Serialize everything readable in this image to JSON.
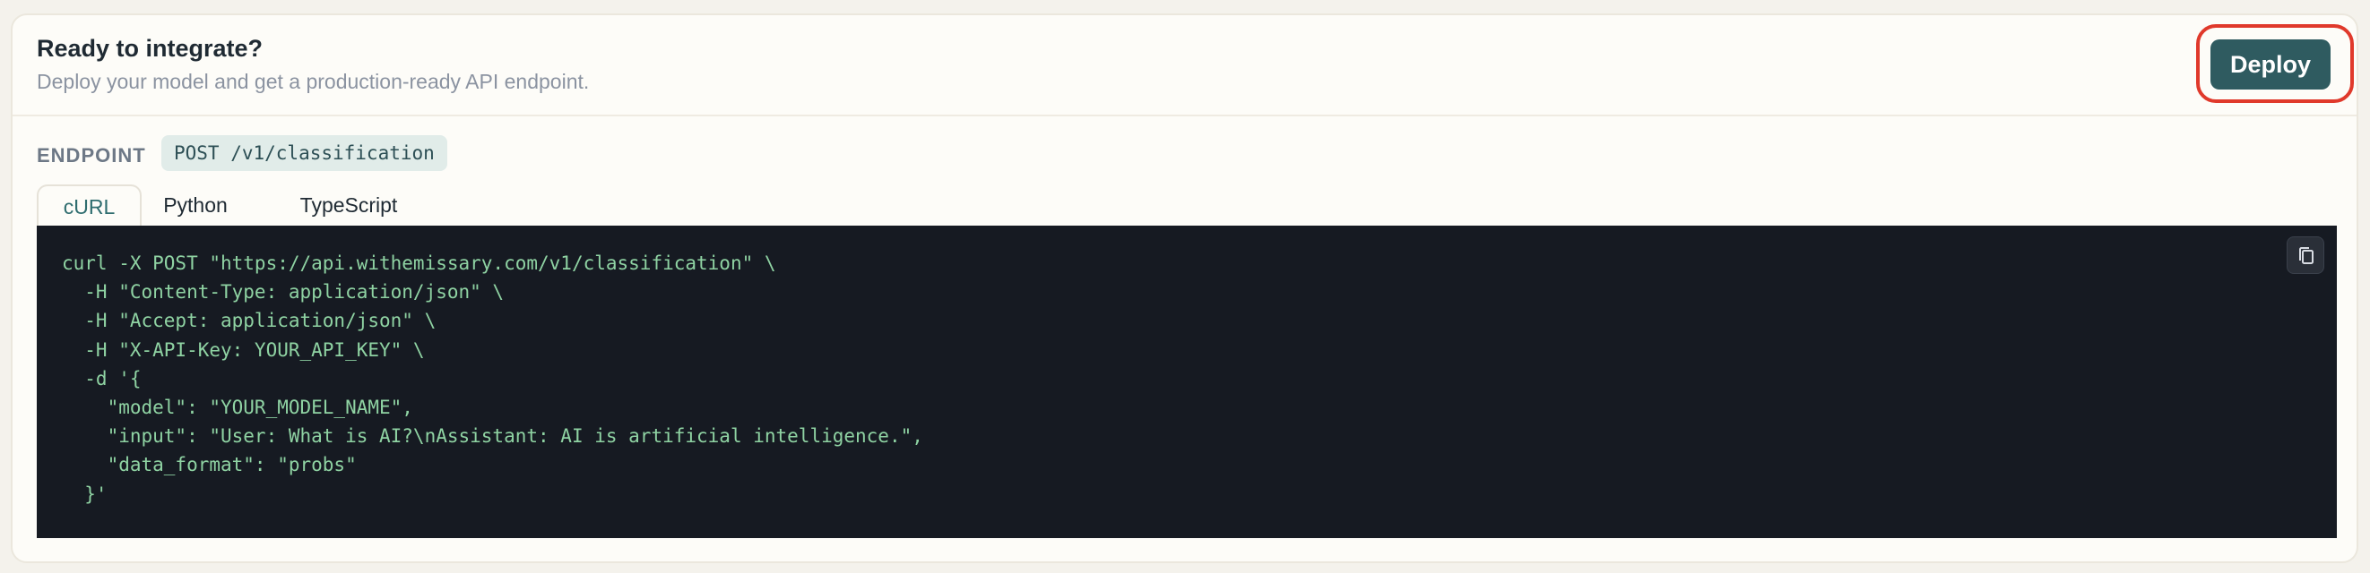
{
  "header": {
    "title": "Ready to integrate?",
    "subtitle": "Deploy your model and get a production-ready API endpoint.",
    "deploy_label": "Deploy"
  },
  "endpoint": {
    "label": "ENDPOINT",
    "value": "POST /v1/classification"
  },
  "tabs": [
    {
      "label": "cURL",
      "active": true
    },
    {
      "label": "Python",
      "active": false
    },
    {
      "label": "TypeScript",
      "active": false
    }
  ],
  "code": {
    "lines": [
      "curl -X POST \"https://api.withemissary.com/v1/classification\" \\",
      "  -H \"Content-Type: application/json\" \\",
      "  -H \"Accept: application/json\" \\",
      "  -H \"X-API-Key: YOUR_API_KEY\" \\",
      "  -d '{",
      "    \"model\": \"YOUR_MODEL_NAME\",",
      "    \"input\": \"User: What is AI?\\nAssistant: AI is artificial intelligence.\",",
      "    \"data_format\": \"probs\"",
      "  }'"
    ],
    "copy_icon": "copy-icon"
  },
  "colors": {
    "accent": "#2f5b60",
    "highlight": "#e0392b",
    "code_background": "#161a22",
    "code_text": "#8fd3a3"
  }
}
